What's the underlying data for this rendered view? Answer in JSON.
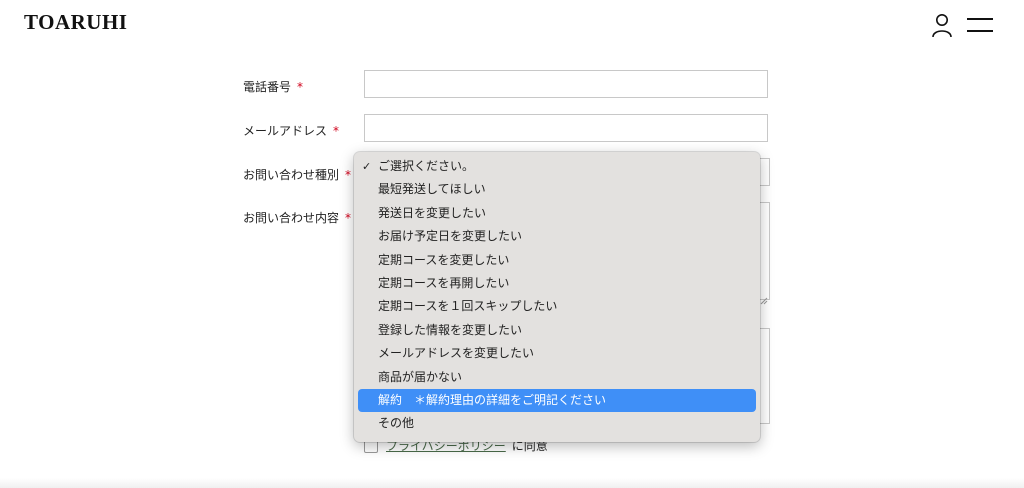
{
  "header": {
    "logo": "TOARUHI",
    "user_icon": "user-icon",
    "menu_icon": "hamburger-menu-icon"
  },
  "form": {
    "phone_label": "電話番号",
    "email_label": "メールアドレス",
    "inquiry_type_label": "お問い合わせ種別",
    "inquiry_content_label": "お問い合わせ内容",
    "required_mark": "*",
    "phone_value": "",
    "email_value": "",
    "policy_link": "プライバシーポリシー",
    "agree_suffix": "に同意",
    "agree_checked": false
  },
  "dropdown": {
    "options": [
      {
        "label": "ご選択ください。",
        "checked": true
      },
      {
        "label": "最短発送してほしい"
      },
      {
        "label": "発送日を変更したい"
      },
      {
        "label": "お届け予定日を変更したい"
      },
      {
        "label": "定期コースを変更したい"
      },
      {
        "label": "定期コースを再開したい"
      },
      {
        "label": "定期コースを１回スキップしたい"
      },
      {
        "label": "登録した情報を変更したい"
      },
      {
        "label": "メールアドレスを変更したい"
      },
      {
        "label": "商品が届かない"
      },
      {
        "label": "解約　＊解約理由の詳細をご明記ください",
        "highlighted": true
      },
      {
        "label": "その他"
      }
    ],
    "check_glyph": "✓",
    "highlight_color": "#3f8ff7"
  }
}
